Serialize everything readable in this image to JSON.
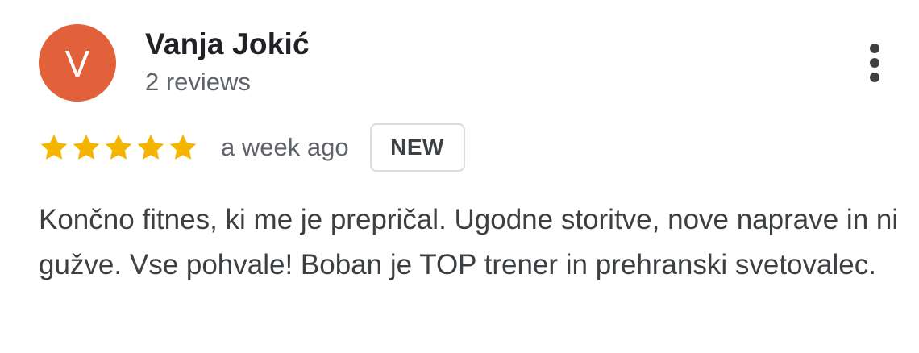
{
  "review": {
    "author": {
      "initial": "V",
      "name": "Vanja Jokić",
      "review_count": "2 reviews",
      "avatar_color": "#e2603a"
    },
    "rating": {
      "stars": 5,
      "max_stars": 5,
      "star_color": "#f4b400"
    },
    "time_ago": "a week ago",
    "badge": "NEW",
    "text": "Končno fitnes, ki me je prepričal. Ugodne storitve, nove naprave in ni gužve. Vse pohvale! Boban je TOP trener in prehranski svetovalec.",
    "menu_icon": "more-vert-icon"
  }
}
